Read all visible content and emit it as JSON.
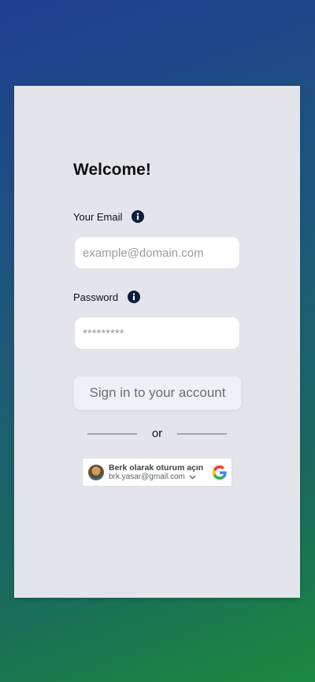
{
  "login": {
    "title": "Welcome!",
    "email_label": "Your Email",
    "email_placeholder": "example@domain.com",
    "email_value": "",
    "password_label": "Password",
    "password_placeholder": "*********",
    "password_value": "",
    "signin_label": "Sign in to your account",
    "divider_text": "or"
  },
  "google": {
    "account_name": "Berk olarak oturum açın",
    "account_email": "brk.yasar@gmail.com",
    "icon": "google-g-icon"
  },
  "colors": {
    "card_bg": "#e4e5ea",
    "info_icon": "#0b1e3c",
    "gradient_start": "#1f3f92",
    "gradient_end": "#1b8a3e"
  }
}
